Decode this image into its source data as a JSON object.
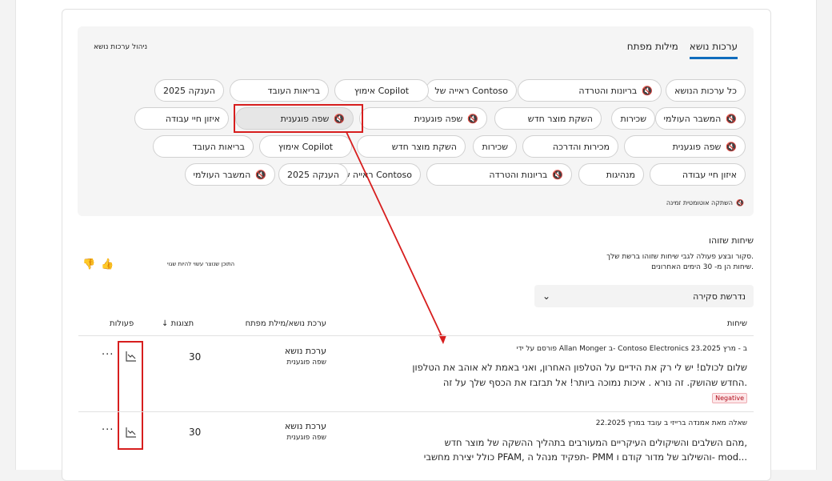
{
  "tabs": [
    "ערכות נושא",
    "מילות מפתח"
  ],
  "manage_label": "ניהול ערכות נושא",
  "chips": [
    {
      "label": "כל ערכות הנושא",
      "muted": false
    },
    {
      "label": "בריונות והטרדה",
      "muted": true
    },
    {
      "label": "ראייה של Contoso",
      "muted": false
    },
    {
      "label": "אימוץ Copilot",
      "muted": false
    },
    {
      "label": "בריאות העובד",
      "muted": false
    },
    {
      "label": "הענקה 2025",
      "muted": false
    },
    {
      "label": "המשבר העולמי",
      "muted": true
    },
    {
      "label": "שכירות",
      "muted": false
    },
    {
      "label": "השקת מוצר חדש",
      "muted": false
    },
    {
      "label": "שפה פוגענית",
      "muted": true
    },
    {
      "label": "שפה פוגענית",
      "muted": true
    },
    {
      "label": "איזון חיי עבודה",
      "muted": false
    },
    {
      "label": "שפה פוגענית",
      "muted": true
    },
    {
      "label": "מכירות והדרכה",
      "muted": false
    },
    {
      "label": "שכירות",
      "muted": false
    },
    {
      "label": "השקת מוצר חדש",
      "muted": false
    },
    {
      "label": "אימוץ Copilot",
      "muted": false
    },
    {
      "label": "בריאות העובד",
      "muted": false
    },
    {
      "label": "איזון חיי עבודה",
      "muted": false
    },
    {
      "label": "מנהיגות",
      "muted": false
    },
    {
      "label": "בריונות והטרדה",
      "muted": true
    },
    {
      "label": "ראייה של Contoso",
      "muted": false
    },
    {
      "label": "הענקה 2025",
      "muted": false
    },
    {
      "label": "המשבר העולמי",
      "muted": true
    }
  ],
  "auto_mute_label": "השתקה אוטומטית זמינה",
  "section": {
    "title": "שיחות שזוהו",
    "sub1": "סקור ובצע פעולה לגבי שיחות שזוהו ברשת שלך.",
    "sub2": "שיחות הן מ- 30 הימים האחרונים.",
    "feedback_note": "התוכן שנוצר עשוי להיות שגוי"
  },
  "dropdown": {
    "label": "נדרשת סקירה"
  },
  "table": {
    "headers": {
      "conversations": "שיחות",
      "topic": "ערכת נושא/מילת מפתח",
      "views": "תצוגות",
      "actions": "פעולות"
    },
    "rows": [
      {
        "meta": "פורסם על ידי Allan Monger ב- Contoso Electronics ב - מרץ 23.2025",
        "lines": [
          "שלום לכולם! יש לי רק את הידיים על הטלפון האחרון, ואני באמת לא אוהב את הטלפון",
          "החדש שהושק. זה נורא . איכות נמוכה ביותר! אל תבזבז את הכסף שלך על זה."
        ],
        "badge": "Negative",
        "topic_type": "ערכת נושא",
        "topic_name": "שפה פוגענית",
        "views": "30"
      },
      {
        "meta": "שאלה מאת אמנדה ברייזי ב עובד במרץ 22.2025",
        "lines": [
          "מהם השלבים והשיקולים העיקריים המעורבים בתהליך ההשקה של מוצר חדש,",
          "כולל יצירת מחשבי PFAM, תפקיד מנהל ה- PMM והשילוב של מדור קודם ו- mod..."
        ],
        "badge": "",
        "topic_type": "ערכת נושא",
        "topic_name": "שפה פוגענית",
        "views": "30"
      }
    ]
  },
  "colors": {
    "accent": "#0f6cbd",
    "annotation_red": "#d71e1e",
    "negative": "#b10e1c"
  }
}
